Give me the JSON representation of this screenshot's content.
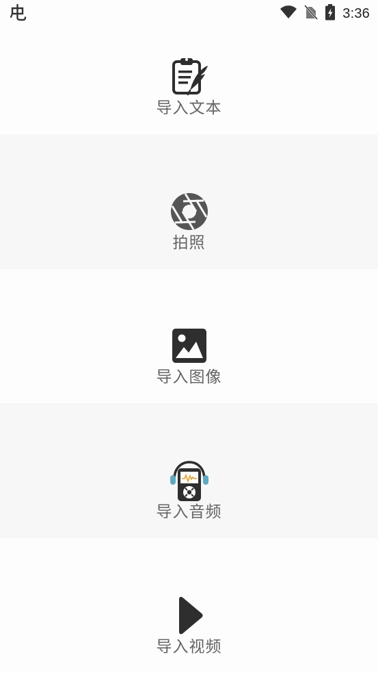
{
  "status_bar": {
    "time": "3:36",
    "left_icon": "app-notification-icon",
    "icons": [
      "wifi-icon",
      "no-sim-icon",
      "battery-charging-icon"
    ]
  },
  "menu": {
    "items": [
      {
        "label": "导入文本",
        "icon": "clipboard-quill-icon"
      },
      {
        "label": "拍照",
        "icon": "camera-shutter-icon"
      },
      {
        "label": "导入图像",
        "icon": "image-icon"
      },
      {
        "label": "导入音频",
        "icon": "audio-player-icon"
      },
      {
        "label": "导入视频",
        "icon": "play-icon"
      }
    ]
  },
  "colors": {
    "background": "#fcfdfc",
    "alt_background": "#f6f7f6",
    "label": "#646464",
    "icon": "#333333",
    "accent_headphone": "#5ea9c0"
  }
}
